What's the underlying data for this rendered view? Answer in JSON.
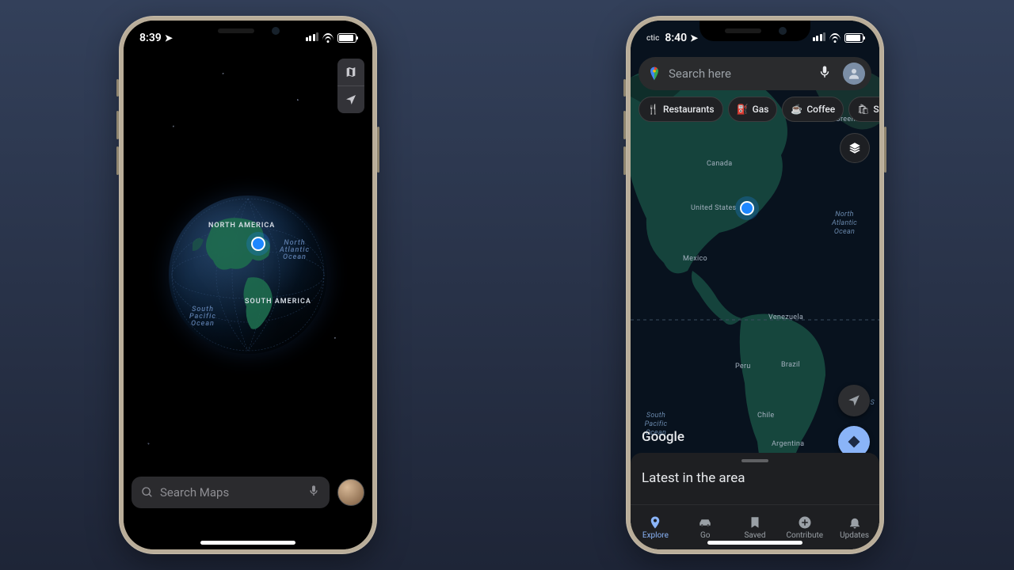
{
  "apple": {
    "status": {
      "time": "8:39"
    },
    "controls": {
      "map_mode": "map-mode-icon",
      "location": "location-arrow-icon"
    },
    "globe_labels": {
      "north_america": "NORTH AMERICA",
      "south_america": "SOUTH AMERICA",
      "north_atlantic": "North Atlantic Ocean",
      "south_pacific": "South Pacific Ocean"
    },
    "search_placeholder": "Search Maps"
  },
  "gmaps": {
    "status": {
      "carrier": "ctic",
      "time": "8:40"
    },
    "search_placeholder": "Search here",
    "chips": [
      {
        "label": "Restaurants",
        "icon": "restaurant-icon"
      },
      {
        "label": "Gas",
        "icon": "gas-icon"
      },
      {
        "label": "Coffee",
        "icon": "coffee-icon"
      },
      {
        "label": "Shopping",
        "icon": "shopping-icon"
      }
    ],
    "map_labels": {
      "greenland": "Greenland",
      "canada": "Canada",
      "united_states": "United States",
      "mexico": "Mexico",
      "venezuela": "Venezuela",
      "brazil": "Brazil",
      "peru": "Peru",
      "chile": "Chile",
      "argentina": "Argentina",
      "north_atlantic": "North Atlantic Ocean",
      "south_pacific": "South Pacific Ocean",
      "s_label": "S"
    },
    "logo": "Google",
    "sheet_title": "Latest in the area",
    "nav": [
      {
        "label": "Explore",
        "icon": "explore-icon",
        "active": true
      },
      {
        "label": "Go",
        "icon": "go-icon",
        "active": false
      },
      {
        "label": "Saved",
        "icon": "saved-icon",
        "active": false
      },
      {
        "label": "Contribute",
        "icon": "contribute-icon",
        "active": false
      },
      {
        "label": "Updates",
        "icon": "updates-icon",
        "active": false
      }
    ]
  }
}
